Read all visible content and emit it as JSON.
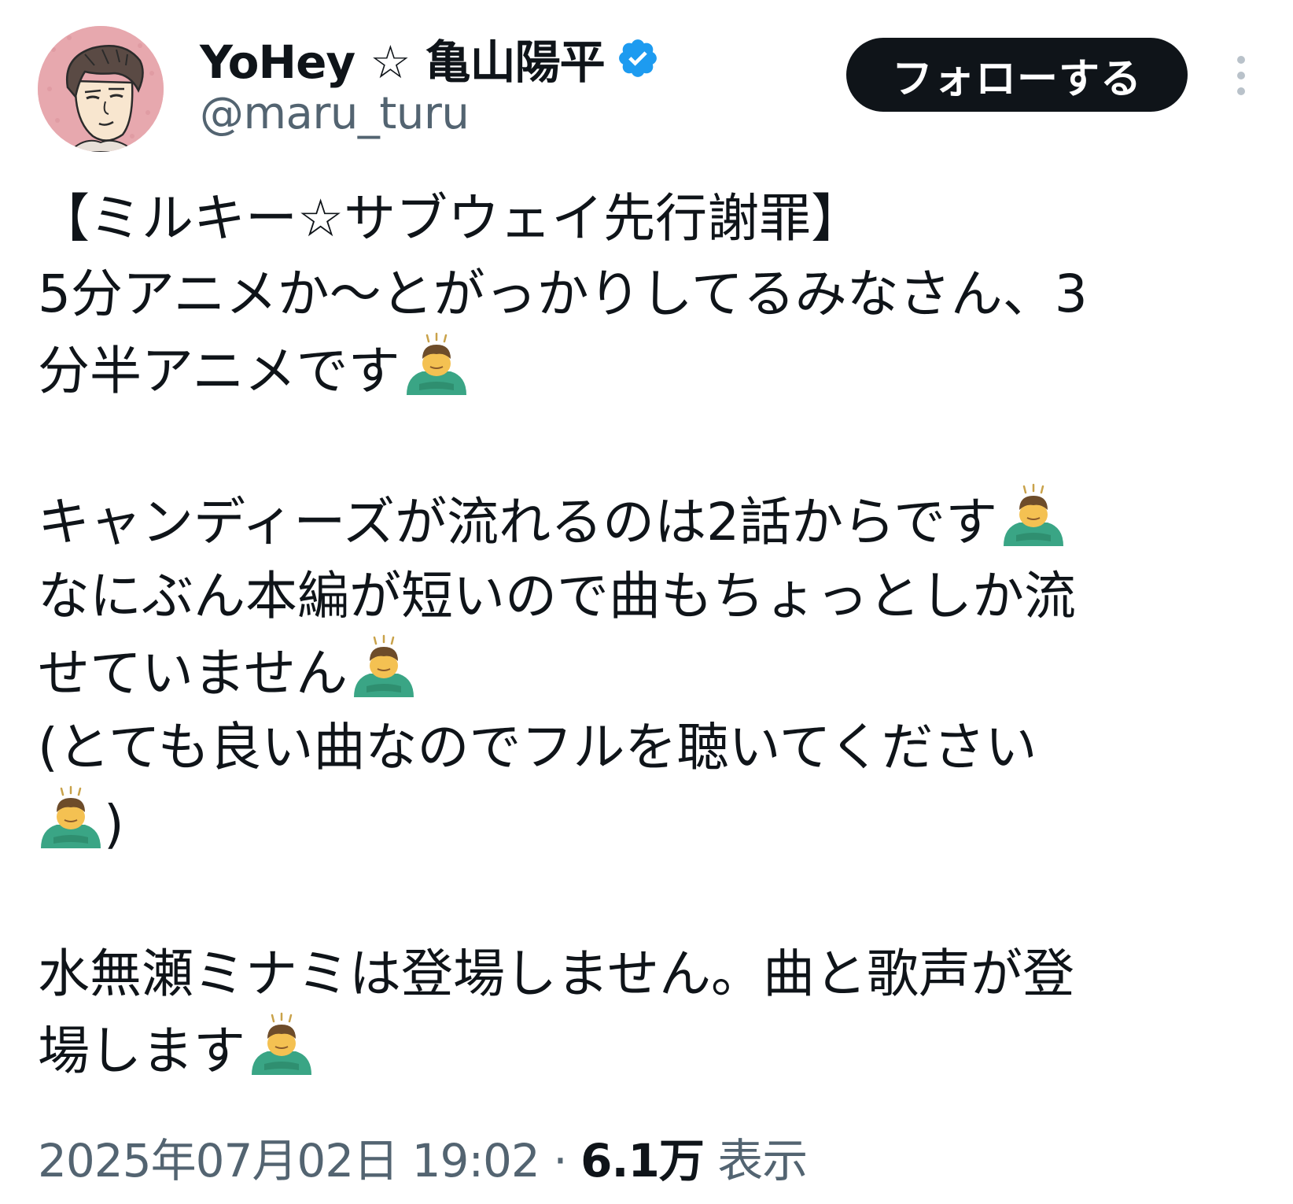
{
  "author": {
    "display_name": "YoHey ☆ 亀山陽平",
    "handle": "@maru_turu",
    "verified_icon": "verified-badge-icon",
    "avatar_bg": "#e7a8ae"
  },
  "actions": {
    "follow_label": "フォローする",
    "more_icon": "more-vertical-icon"
  },
  "tweet": {
    "lines": [
      "【ミルキー☆サブウェイ先行謝罪】",
      "5分アニメか〜とがっかりしてるみなさん、3",
      "分半アニメです",
      "",
      "キャンディーズが流れるのは2話からです",
      "なにぶん本編が短いので曲もちょっとしか流",
      "せていません",
      "(とても良い曲なのでフルを聴いてください",
      ")",
      "",
      "水無瀬ミナミは登場しません。曲と歌声が登",
      "場します"
    ],
    "emoji_name": "person-bowing-emoji"
  },
  "meta": {
    "timestamp": "2025年07月02日 19:02",
    "separator": "·",
    "view_count": "6.1万",
    "view_label": "表示"
  },
  "colors": {
    "text": "#0f1419",
    "secondary": "#536471",
    "verified": "#1d9bf0",
    "follow_bg": "#0f1419"
  }
}
